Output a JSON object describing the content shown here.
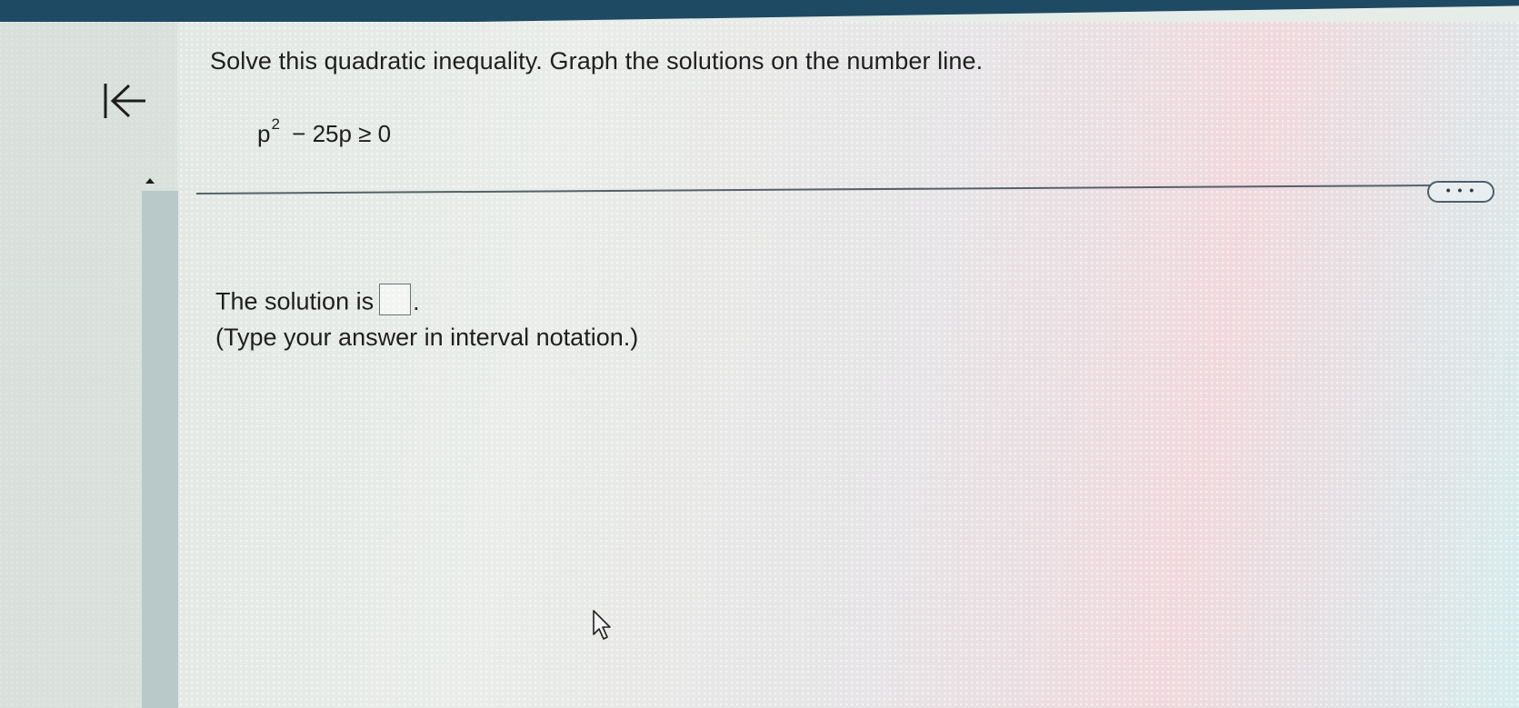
{
  "nav": {
    "back_icon": "back-to-start-icon"
  },
  "question": {
    "instruction": "Solve this quadratic inequality. Graph the solutions on the number line.",
    "equation": {
      "variable": "p",
      "exponent": "2",
      "rest": " − 25p ≥ 0"
    }
  },
  "toolbar": {
    "more_label": "• • •"
  },
  "answer": {
    "prompt": "The solution is",
    "input_value": "",
    "period": ".",
    "hint": "(Type your answer in interval notation.)"
  },
  "colors": {
    "top_bar": "#1e4a63",
    "scroll_track": "#b9c8c8",
    "text": "#1f1f1f"
  }
}
